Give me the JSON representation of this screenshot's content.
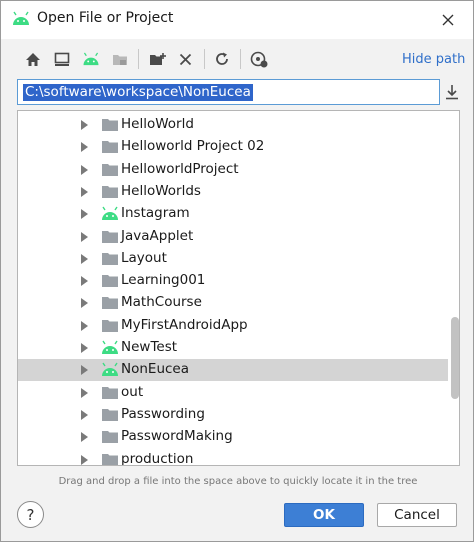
{
  "window": {
    "title": "Open File or Project",
    "close_icon": "close-icon",
    "app_icon": "android-icon"
  },
  "toolbar": {
    "buttons": [
      {
        "name": "home-icon"
      },
      {
        "name": "desktop-icon"
      },
      {
        "name": "android-icon"
      },
      {
        "name": "project-folder-icon"
      },
      {
        "name": "new-folder-icon"
      },
      {
        "name": "delete-icon"
      },
      {
        "name": "refresh-icon"
      },
      {
        "name": "show-hidden-icon"
      }
    ],
    "hide_path_label": "Hide path"
  },
  "path": {
    "value": "C:\\software\\workspace\\NonEucea"
  },
  "tree": {
    "items": [
      {
        "label": "HelloWorld",
        "icon": "folder"
      },
      {
        "label": "Helloworld Project 02",
        "icon": "folder"
      },
      {
        "label": "HelloworldProject",
        "icon": "folder"
      },
      {
        "label": "HelloWorlds",
        "icon": "folder"
      },
      {
        "label": "Instagram",
        "icon": "android"
      },
      {
        "label": "JavaApplet",
        "icon": "folder"
      },
      {
        "label": "Layout",
        "icon": "folder"
      },
      {
        "label": "Learning001",
        "icon": "folder"
      },
      {
        "label": "MathCourse",
        "icon": "folder"
      },
      {
        "label": "MyFirstAndroidApp",
        "icon": "folder"
      },
      {
        "label": "NewTest",
        "icon": "android"
      },
      {
        "label": "NonEucea",
        "icon": "android",
        "selected": true
      },
      {
        "label": "out",
        "icon": "folder"
      },
      {
        "label": "Passwording",
        "icon": "folder"
      },
      {
        "label": "PasswordMaking",
        "icon": "folder"
      },
      {
        "label": "production",
        "icon": "folder"
      }
    ]
  },
  "hint": "Drag and drop a file into the space above to quickly locate it in the tree",
  "footer": {
    "help_label": "?",
    "ok_label": "OK",
    "cancel_label": "Cancel"
  },
  "colors": {
    "android_green": "#3ddc84",
    "accent_blue": "#3d7fd5",
    "selection": "#d4d4d4"
  }
}
